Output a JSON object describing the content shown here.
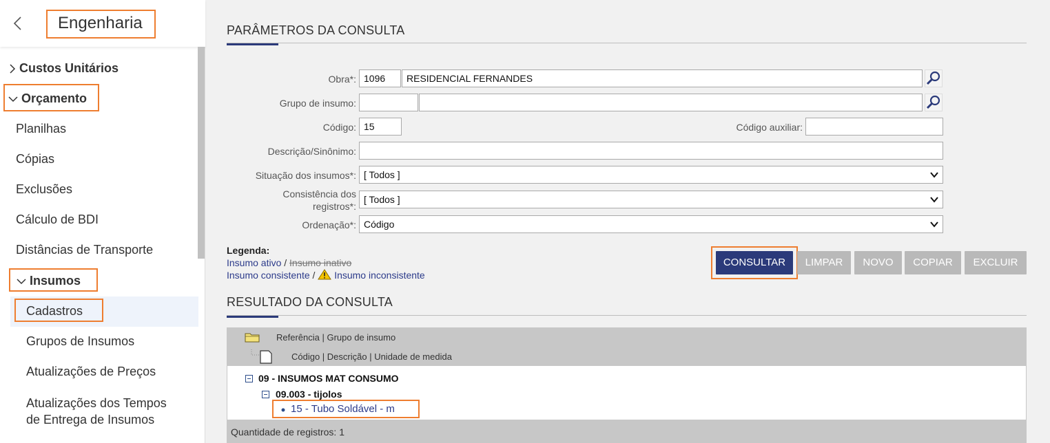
{
  "sidebar": {
    "title": "Engenharia",
    "items": [
      {
        "label": "Custos Unitários",
        "expanded": false
      },
      {
        "label": "Orçamento",
        "expanded": true
      },
      {
        "label": "Planilhas"
      },
      {
        "label": "Cópias"
      },
      {
        "label": "Exclusões"
      },
      {
        "label": "Cálculo de BDI"
      },
      {
        "label": "Distâncias de Transporte"
      },
      {
        "label": "Insumos",
        "expanded": true
      },
      {
        "label": "Cadastros",
        "active": true
      },
      {
        "label": "Grupos de Insumos"
      },
      {
        "label": "Atualizações de Preços"
      },
      {
        "label": "Atualizações dos Tempos"
      },
      {
        "label": "de Entrega de Insumos"
      }
    ]
  },
  "params": {
    "title": "PARÂMETROS DA CONSULTA",
    "obra_label": "Obra*:",
    "obra_code": "1096",
    "obra_name": "RESIDENCIAL FERNANDES",
    "grupo_label": "Grupo de insumo:",
    "grupo_code": "",
    "grupo_name": "",
    "codigo_label": "Código:",
    "codigo_value": "15",
    "codigo_aux_label": "Código auxiliar:",
    "codigo_aux_value": "",
    "descricao_label": "Descrição/Sinônimo:",
    "descricao_value": "",
    "situacao_label": "Situação dos insumos*:",
    "situacao_value": "[ Todos ]",
    "consistencia_label_1": "Consistência dos",
    "consistencia_label_2": "registros*:",
    "consistencia_value": "[ Todos ]",
    "ordenacao_label": "Ordenação*:",
    "ordenacao_value": "Código"
  },
  "legend": {
    "title": "Legenda:",
    "ativo": "Insumo ativo",
    "sep": "/",
    "inativo": "Insumo inativo",
    "consistente": "Insumo consistente",
    "inconsistente": "Insumo inconsistente"
  },
  "buttons": {
    "consultar": "CONSULTAR",
    "limpar": "LIMPAR",
    "novo": "NOVO",
    "copiar": "COPIAR",
    "excluir": "EXCLUIR"
  },
  "results": {
    "title": "RESULTADO DA CONSULTA",
    "header_group": "Referência | Grupo de insumo",
    "header_item": "Código | Descrição | Unidade de medida",
    "group": "09 - INSUMOS MAT CONSUMO",
    "subgroup": "09.003 - tijolos",
    "item": "15 - Tubo Soldável - m",
    "count_text": "Quantidade de registros: 1"
  },
  "colors": {
    "accent": "#2b3a7a",
    "highlight": "#ee7d2f",
    "button_disabled": "#b9b9b9"
  }
}
